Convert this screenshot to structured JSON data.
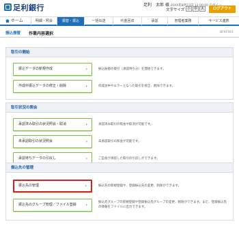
{
  "header": {
    "logo_text": "足利銀行",
    "user_name": "足利　太郎 様",
    "login_info": "20XX年8月23日 12:00:00 ログイン",
    "font_size_label": "文字サイズ",
    "font_small": "小",
    "font_medium": "中",
    "font_large": "大",
    "logout_label": "ログアウト"
  },
  "nav": {
    "home": "ホーム",
    "items": [
      "明細・照会",
      "振替・振込",
      "一括伝送",
      "代金回収",
      "承認",
      "管理者業務",
      "サービス連携"
    ]
  },
  "page": {
    "breadcrumb": "振込振替",
    "title": "作業内容選択",
    "screen_id": "BFKF001"
  },
  "sections": [
    {
      "title": "取引の開始",
      "rows": [
        {
          "button": "振込データの新規作成",
          "desc": "振込振替の取引（承認待ち分）を開始できます。"
        },
        {
          "button": "作成中振込データの修正・削除",
          "desc": "作成途中やエラーとなった取引を修正、削除できます。"
        }
      ]
    },
    {
      "title": "取引状況の照会",
      "rows": [
        {
          "button": "承認済み取引の状況照会・取消",
          "desc": "承認済み取引の照会や取消が可能です。"
        },
        {
          "button": "未承認取引の状況照会",
          "desc": "未承認取引の照会が可能です。"
        },
        {
          "button": "承認待ちデータの引戻し",
          "desc": "ご自身が承認した取引の引戻しができます。"
        }
      ]
    },
    {
      "title": "振込先の管理",
      "rows": [
        {
          "button": "振込先の管理",
          "desc": "振込先の新規登録や、登録振込先の変更、削除ができます。"
        },
        {
          "button": "振込先のグループ管理／ファイル登録",
          "desc": "振込先グループの新規登録や登録振込先グループの変更、削除ができます。また、登録振込先の情報をファイルに出力できます。"
        }
      ]
    }
  ]
}
